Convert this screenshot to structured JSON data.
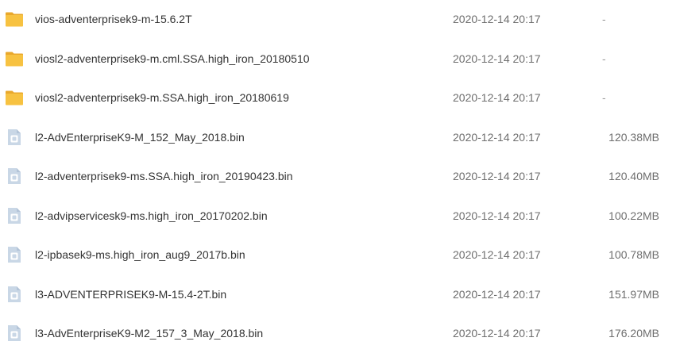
{
  "colors": {
    "folder_icon": "#f7c241",
    "folder_icon_tab": "#e9a82c",
    "file_icon": "#c9d7e6",
    "file_icon_mark": "#ffffff",
    "name_text": "#333333",
    "meta_text": "#6e6e6e"
  },
  "files": [
    {
      "icon": "folder-icon",
      "name": "vios-adventerprisek9-m-15.6.2T",
      "date": "2020-12-14 20:17",
      "size": "-"
    },
    {
      "icon": "folder-icon",
      "name": "viosl2-adventerprisek9-m.cml.SSA.high_iron_20180510",
      "date": "2020-12-14 20:17",
      "size": "-"
    },
    {
      "icon": "folder-icon",
      "name": "viosl2-adventerprisek9-m.SSA.high_iron_20180619",
      "date": "2020-12-14 20:17",
      "size": "-"
    },
    {
      "icon": "file-icon",
      "name": "l2-AdvEnterpriseK9-M_152_May_2018.bin",
      "date": "2020-12-14 20:17",
      "size": "120.38MB"
    },
    {
      "icon": "file-icon",
      "name": "l2-adventerprisek9-ms.SSA.high_iron_20190423.bin",
      "date": "2020-12-14 20:17",
      "size": "120.40MB"
    },
    {
      "icon": "file-icon",
      "name": "l2-advipservicesk9-ms.high_iron_20170202.bin",
      "date": "2020-12-14 20:17",
      "size": "100.22MB"
    },
    {
      "icon": "file-icon",
      "name": "l2-ipbasek9-ms.high_iron_aug9_2017b.bin",
      "date": "2020-12-14 20:17",
      "size": "100.78MB"
    },
    {
      "icon": "file-icon",
      "name": "l3-ADVENTERPRISEK9-M-15.4-2T.bin",
      "date": "2020-12-14 20:17",
      "size": "151.97MB"
    },
    {
      "icon": "file-icon",
      "name": "l3-AdvEnterpriseK9-M2_157_3_May_2018.bin",
      "date": "2020-12-14 20:17",
      "size": "176.20MB"
    }
  ]
}
